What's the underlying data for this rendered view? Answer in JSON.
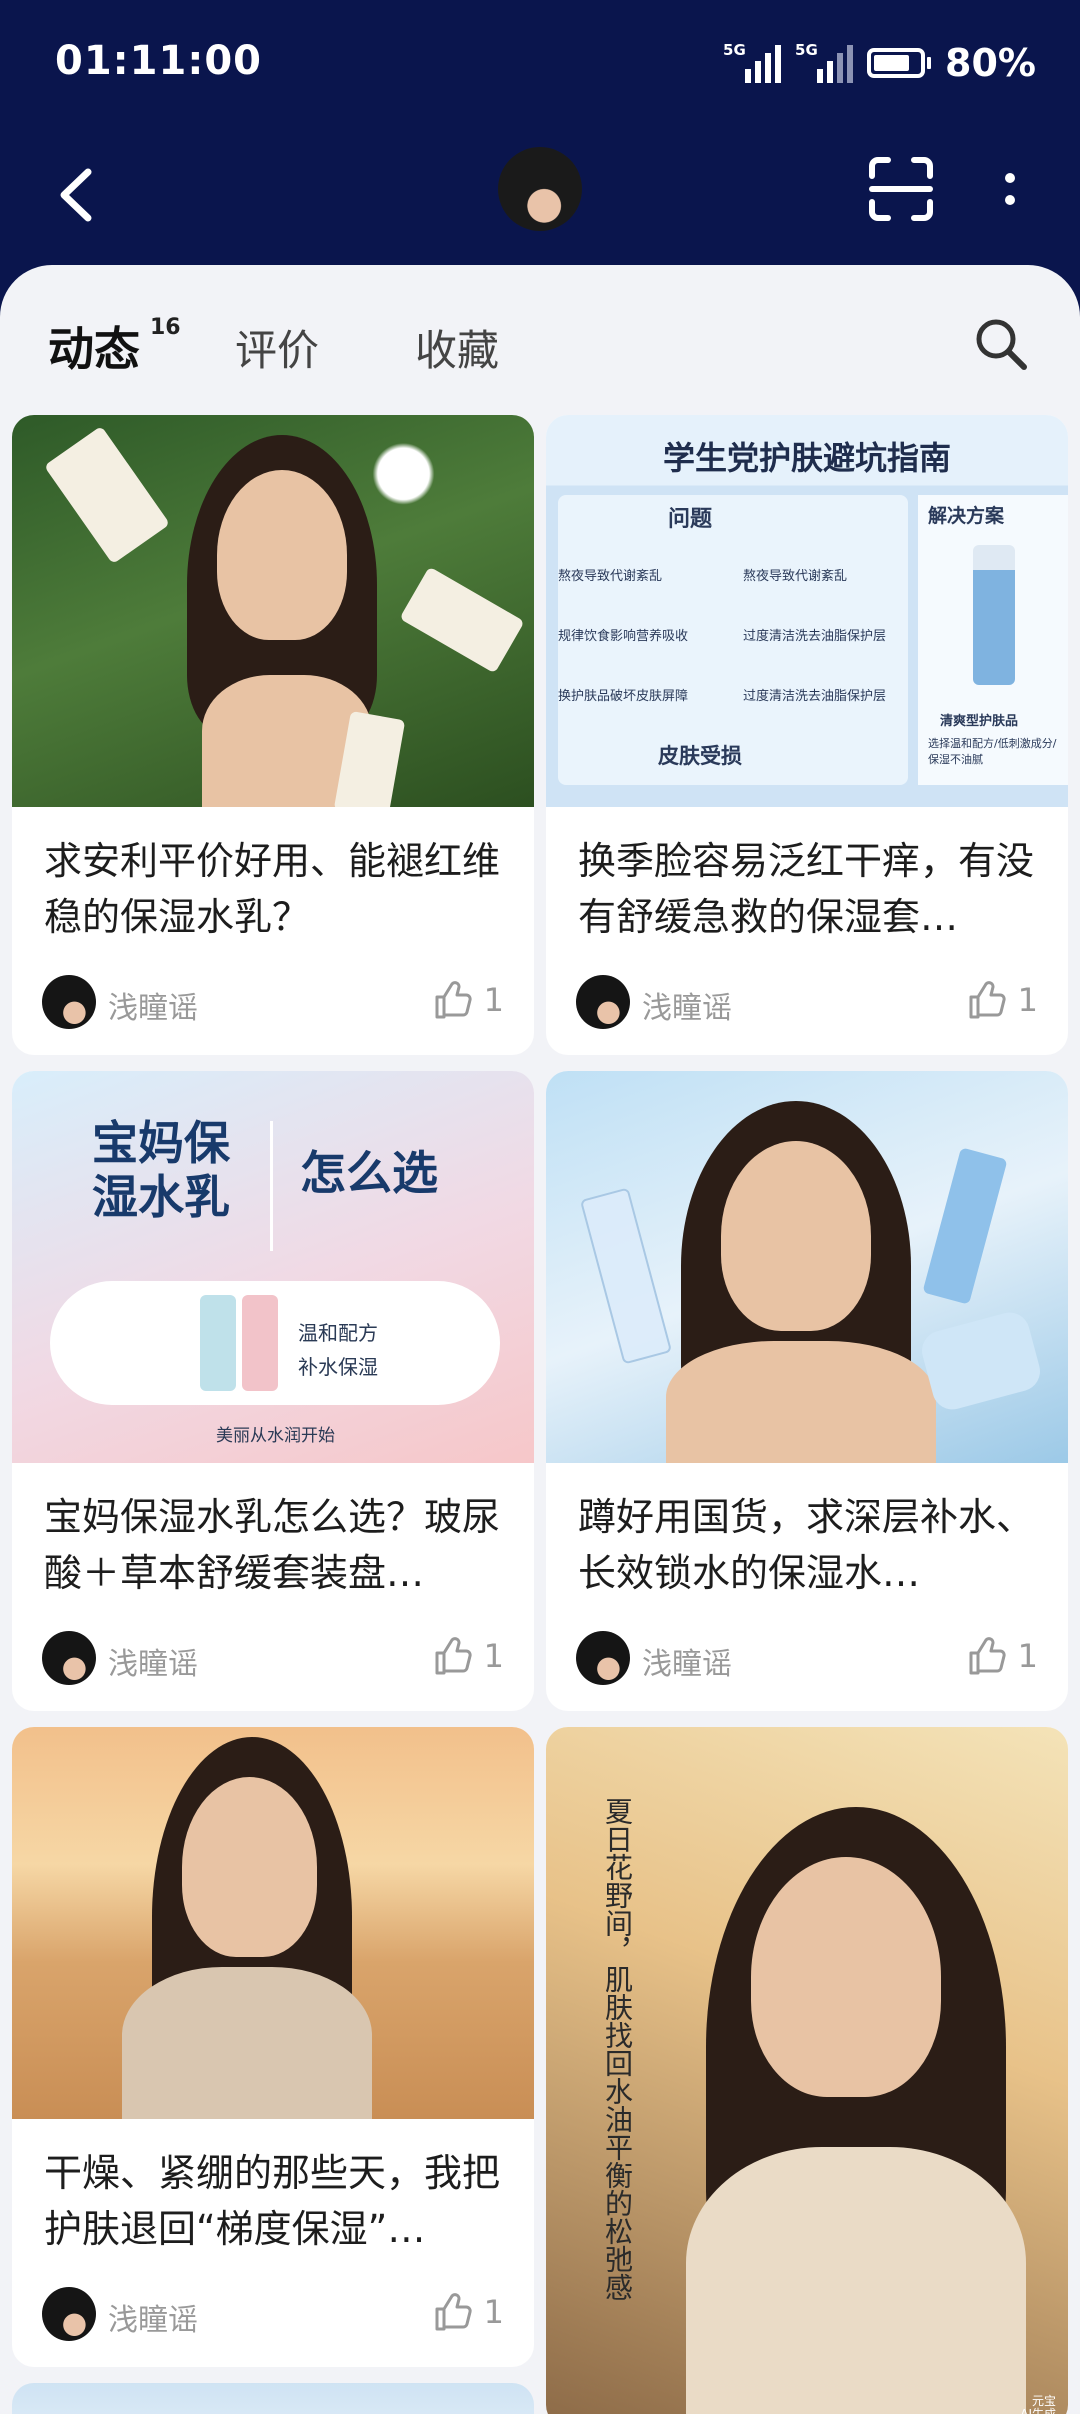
{
  "status": {
    "time": "01:11:00",
    "signal1_tag": "5G",
    "signal2_tag": "5G",
    "battery_pct": "80%",
    "battery_level": 0.8
  },
  "nav": {
    "back_icon": "chevron-left-icon",
    "scan_icon": "scan-icon",
    "more_icon": "more-vertical-icon"
  },
  "tabs": [
    {
      "label": "动态",
      "badge": "16",
      "active": true
    },
    {
      "label": "评价",
      "active": false
    },
    {
      "label": "收藏",
      "active": false
    }
  ],
  "posts": [
    {
      "title": "求安利平价好用、能褪红维稳的保湿水乳？",
      "author": "浅瞳谣",
      "likes": "1"
    },
    {
      "title": "换季脸容易泛红干痒，有没有舒缓急救的保湿套…",
      "author": "浅瞳谣",
      "likes": "1",
      "image_text": {
        "title": "学生党护肤避坑指南",
        "problem": "问题",
        "solution": "解决方案",
        "items": [
          "熬夜导致代谢紊乱",
          "熬夜导致代谢紊乱",
          "规律饮食影响营养吸收",
          "过度清洁洗去油脂保护层",
          "换护肤品破坏皮肤屏障",
          "过度清洁洗去油脂保护层"
        ],
        "footer": "皮肤受损",
        "product": "清爽型护肤品",
        "product_note": "选择温和配方/低刺激成分/保湿不油腻"
      }
    },
    {
      "title": "宝妈保湿水乳怎么选？玻尿酸＋草本舒缓套装盘…",
      "author": "浅瞳谣",
      "likes": "1",
      "image_text": {
        "h1": "宝妈保\n湿水乳",
        "h2": "怎么选",
        "s1": "温和配方",
        "s2": "补水保湿",
        "footer": "美丽从水润开始"
      }
    },
    {
      "title": "蹲好用国货，求深层补水、长效锁水的保湿水…",
      "author": "浅瞳谣",
      "likes": "1"
    },
    {
      "title": "干燥、紧绷的那些天，我把护肤退回“梯度保湿”…",
      "author": "浅瞳谣",
      "likes": "1"
    },
    {
      "image_text": {
        "vertical": "夏日花野间，肌肤找回水油平衡的松弛感",
        "watermark": "元宝\nAI生成"
      }
    }
  ]
}
